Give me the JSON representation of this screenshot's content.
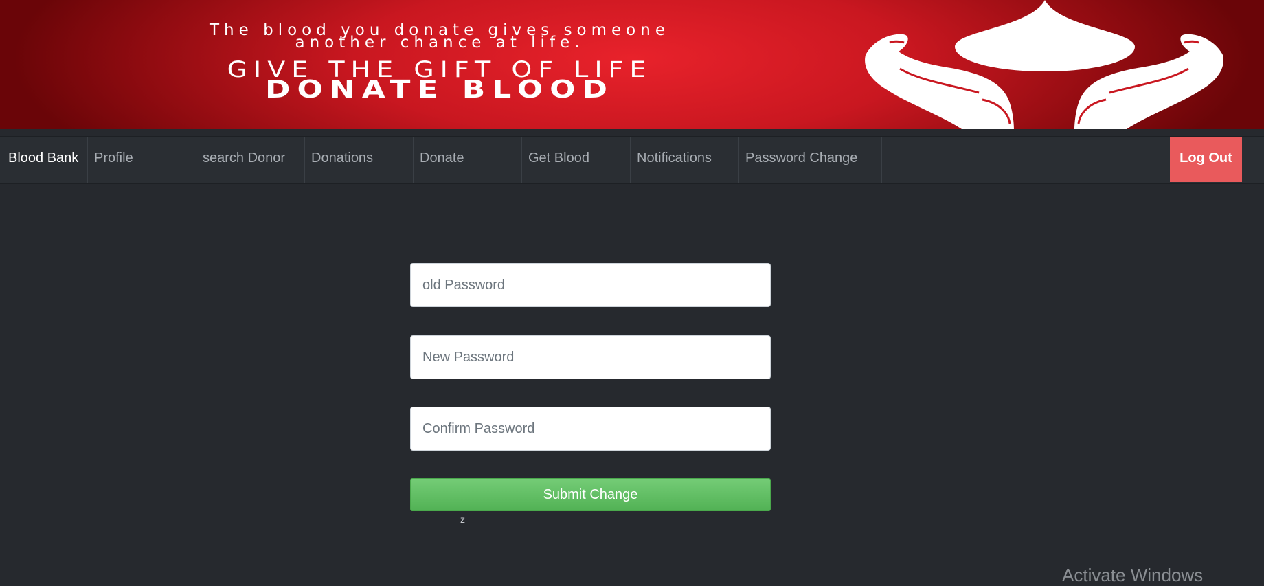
{
  "banner": {
    "tagline_line1": "The blood you donate gives someone",
    "tagline_line2": "another chance at life.",
    "headline": "GIVE THE GIFT OF LIFE",
    "headline2": "DONATE BLOOD"
  },
  "navbar": {
    "brand": "Blood Bank",
    "items": [
      {
        "label": "Profile"
      },
      {
        "label": "search Donor"
      },
      {
        "label": "Donations"
      },
      {
        "label": "Donate"
      },
      {
        "label": "Get Blood"
      },
      {
        "label": "Notifications"
      },
      {
        "label": "Password Change"
      }
    ],
    "logout_label": "Log Out"
  },
  "form": {
    "old_password_placeholder": "old Password",
    "new_password_placeholder": "New Password",
    "confirm_password_placeholder": "Confirm Password",
    "submit_label": "Submit Change",
    "note": "z"
  },
  "watermark": "Activate Windows",
  "colors": {
    "banner_red": "#c91720",
    "navbar_bg": "#2a2e33",
    "page_bg": "#26292e",
    "logout_bg": "#e95a5c",
    "submit_green": "#5cb85c"
  }
}
